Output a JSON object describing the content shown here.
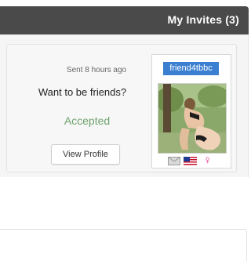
{
  "header": {
    "title": "My Invites (3)"
  },
  "invite": {
    "username": "friend4tbbc",
    "sent": "Sent 8 hours ago",
    "message": "Want to be friends?",
    "status": "Accepted",
    "view_profile_label": "View Profile",
    "icons": [
      "mail-icon",
      "us-flag-icon",
      "female-gender-icon"
    ],
    "status_color": "#6fa36f"
  },
  "colors": {
    "header_bg": "#4a4a4a",
    "username_highlight": "#3a7fd0",
    "gender_icon": "#e6318a"
  }
}
